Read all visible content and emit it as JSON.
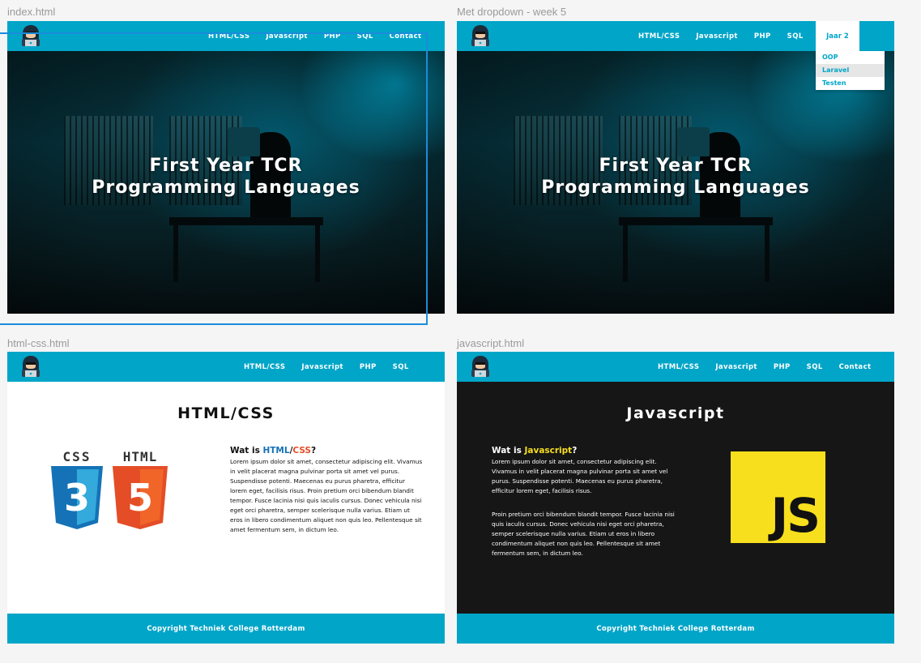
{
  "frames": {
    "index": {
      "label": "index.html"
    },
    "dropdown": {
      "label": "Met dropdown - week 5"
    },
    "htmlcss": {
      "label": "html-css.html"
    },
    "javascript": {
      "label": "javascript.html"
    }
  },
  "nav_full": [
    "HTML/CSS",
    "Javascript",
    "PHP",
    "SQL",
    "Contact"
  ],
  "nav_short": [
    "HTML/CSS",
    "Javascript",
    "PHP",
    "SQL"
  ],
  "dropdown": {
    "tab_label": "Jaar 2",
    "items": [
      "OOP",
      "Laravel",
      "Testen"
    ],
    "active_item": "Laravel"
  },
  "hero": {
    "title_line1": "First Year TCR",
    "title_line2": "Programming Languages"
  },
  "htmlcss_page": {
    "title": "HTML/CSS",
    "intro_prefix": "Wat is ",
    "html_word": "HTML",
    "slash": "/",
    "css_word": "CSS",
    "question": "?",
    "body": "Lorem ipsum dolor sit amet, consectetur adipiscing elit. Vivamus in velit placerat magna pulvinar porta sit amet vel purus. Suspendisse potenti. Maecenas eu purus pharetra, efficitur lorem eget, facilisis risus. Proin pretium orci bibendum blandit tempor. Fusce lacinia nisi quis iaculis cursus. Donec vehicula nisi eget orci pharetra, semper scelerisque nulla varius. Etiam ut eros in libero condimentum aliquet non quis leo. Pellentesque sit amet fermentum sem, in dictum leo.",
    "css_logo_text": "CSS",
    "css_logo_num": "3",
    "html_logo_text": "HTML",
    "html_logo_num": "5"
  },
  "js_page": {
    "title": "Javascript",
    "intro_prefix": "Wat is ",
    "js_word": "Javascript",
    "question": "?",
    "body1": "Lorem ipsum dolor sit amet, consectetur adipiscing elit. Vivamus in velit placerat magna pulvinar porta sit amet vel purus. Suspendisse potenti. Maecenas eu purus pharetra, efficitur lorem eget, facilisis risus.",
    "body2": "Proin pretium orci bibendum blandit tempor. Fusce lacinia nisi quis iaculis cursus. Donec vehicula nisi eget orci pharetra, semper scelerisque nulla varius. Etiam ut eros in libero condimentum aliquet non quis leo. Pellentesque sit amet fermentum sem, in dictum leo.",
    "logo_text": "JS"
  },
  "footer": "Copyright Techniek College Rotterdam",
  "colors": {
    "accent": "#01a5c8",
    "html_blue": "#1572b6",
    "css_orange": "#e44d26",
    "js_yellow": "#f7df1e",
    "dark_bg": "#161616",
    "selection": "#1a8cdb"
  },
  "icons": {
    "logo": "hacker-avatar-icon"
  }
}
